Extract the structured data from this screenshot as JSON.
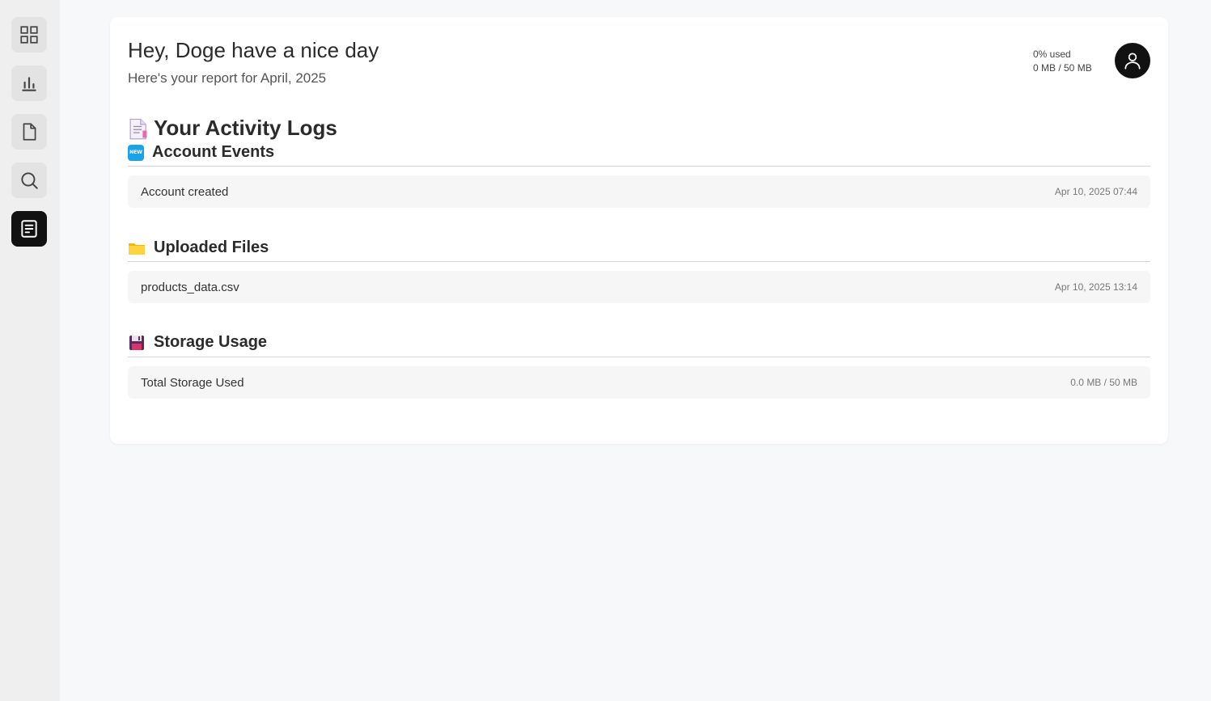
{
  "sidebar": {
    "items": [
      {
        "name": "dashboard",
        "icon": "grid-icon",
        "active": false
      },
      {
        "name": "analytics",
        "icon": "bar-chart-icon",
        "active": false
      },
      {
        "name": "documents",
        "icon": "file-icon",
        "active": false
      },
      {
        "name": "search",
        "icon": "search-icon",
        "active": false
      },
      {
        "name": "activity-logs",
        "icon": "notes-icon",
        "active": true
      }
    ]
  },
  "header": {
    "greeting": "Hey, Doge have a nice day",
    "subtitle": "Here's your report for April, 2025",
    "usage_percent": "0% used",
    "usage_amount": "0 MB / 50 MB",
    "avatar_icon": "user-icon"
  },
  "main": {
    "title": "Your Activity Logs",
    "sections": [
      {
        "title": "Account Events",
        "icon": "new-badge-icon",
        "rows": [
          {
            "label": "Account created",
            "value": "Apr 10, 2025 07:44"
          }
        ]
      },
      {
        "title": "Uploaded Files",
        "icon": "folder-icon",
        "rows": [
          {
            "label": "products_data.csv",
            "value": "Apr 10, 2025 13:14"
          }
        ]
      },
      {
        "title": "Storage Usage",
        "icon": "floppy-disk-icon",
        "rows": [
          {
            "label": "Total Storage Used",
            "value": "0.0 MB / 50 MB"
          }
        ]
      }
    ]
  },
  "colors": {
    "accent": "#111111",
    "background": "#f7f8fa",
    "sidebar": "#efefef",
    "card": "#ffffff"
  }
}
